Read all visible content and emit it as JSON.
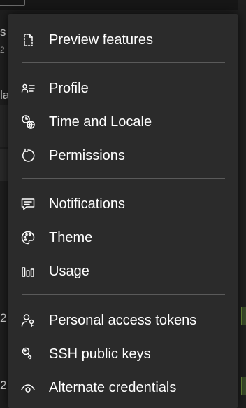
{
  "background": {
    "left_fragments": [
      "s",
      "2",
      "la",
      "2",
      "2"
    ]
  },
  "menu": {
    "items": [
      {
        "label": "Preview features",
        "icon": "document-icon"
      },
      {
        "label": "Profile",
        "icon": "profile-card-icon"
      },
      {
        "label": "Time and Locale",
        "icon": "clock-globe-icon"
      },
      {
        "label": "Permissions",
        "icon": "refresh-circle-icon"
      },
      {
        "label": "Notifications",
        "icon": "chat-bubble-icon"
      },
      {
        "label": "Theme",
        "icon": "palette-icon"
      },
      {
        "label": "Usage",
        "icon": "bar-chart-icon"
      },
      {
        "label": "Personal access tokens",
        "icon": "person-key-icon"
      },
      {
        "label": "SSH public keys",
        "icon": "key-icon"
      },
      {
        "label": "Alternate credentials",
        "icon": "eye-icon"
      }
    ]
  },
  "colors": {
    "menu_bg": "#2b2b2b",
    "separator": "#5a5a5a",
    "text": "#ffffff",
    "status_green": "#6b8f3a"
  }
}
